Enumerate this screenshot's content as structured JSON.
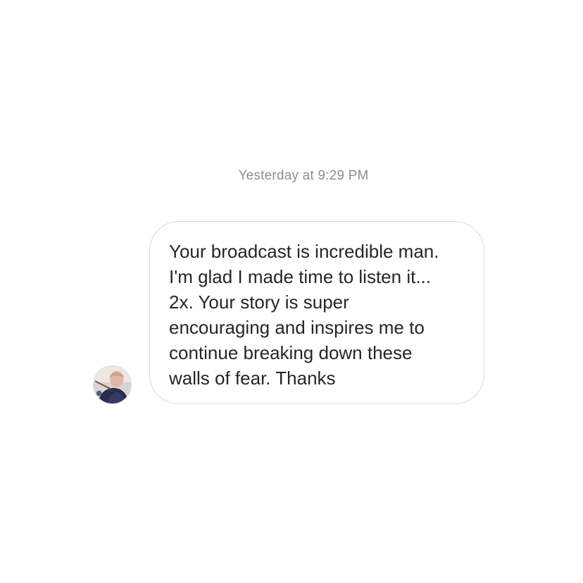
{
  "conversation": {
    "timestamp": "Yesterday at 9:29 PM",
    "messages": [
      {
        "sender": "other",
        "avatar_icon": "profile-photo",
        "text": "Your broadcast is incredible man.\nI'm glad I made time to listen it...\n2x. Your story is super\nencouraging and inspires me to\ncontinue breaking down these\nwalls of fear. Thanks"
      }
    ]
  },
  "colors": {
    "background": "#ffffff",
    "timestamp_text": "#8e8e8e",
    "message_text": "#262626",
    "bubble_border": "#dbdbdb"
  }
}
